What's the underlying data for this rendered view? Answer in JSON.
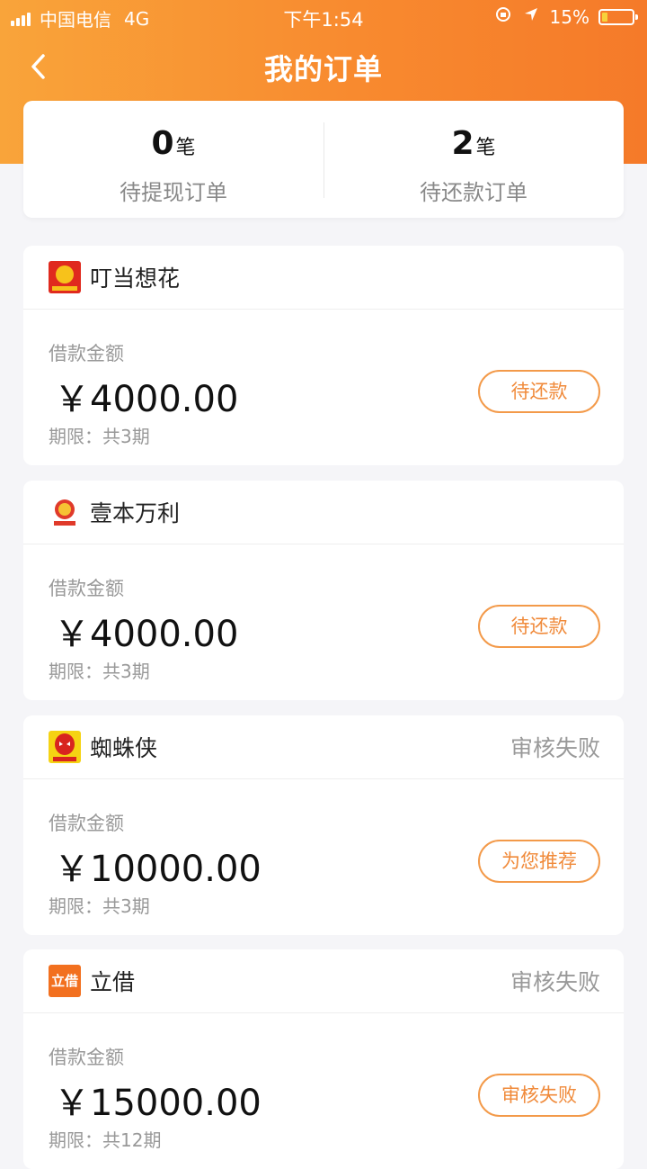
{
  "status_bar": {
    "carrier": "中国电信",
    "network": "4G",
    "time": "下午1:54",
    "battery": "15%",
    "battery_level": 0.15
  },
  "nav": {
    "title": "我的订单"
  },
  "summary": {
    "left": {
      "count": "0",
      "unit": "笔",
      "label": "待提现订单"
    },
    "right": {
      "count": "2",
      "unit": "笔",
      "label": "待还款订单"
    }
  },
  "orders": [
    {
      "name": "叮当想花",
      "status": "",
      "amount_label": "借款金额",
      "amount": "￥4000.00",
      "term": "期限：共3期",
      "action": "待还款",
      "logo": "dingdang-logo"
    },
    {
      "name": "壹本万利",
      "status": "",
      "amount_label": "借款金额",
      "amount": "￥4000.00",
      "term": "期限：共3期",
      "action": "待还款",
      "logo": "yiben-logo"
    },
    {
      "name": "蜘蛛侠",
      "status": "审核失败",
      "amount_label": "借款金额",
      "amount": "￥10000.00",
      "term": "期限：共3期",
      "action": "为您推荐",
      "logo": "spiderman-logo"
    },
    {
      "name": "立借",
      "status": "审核失败",
      "amount_label": "借款金额",
      "amount": "￥15000.00",
      "term": "期限：共12期",
      "action": "审核失败",
      "logo": "lijie-logo",
      "logo_text": "立借"
    }
  ]
}
